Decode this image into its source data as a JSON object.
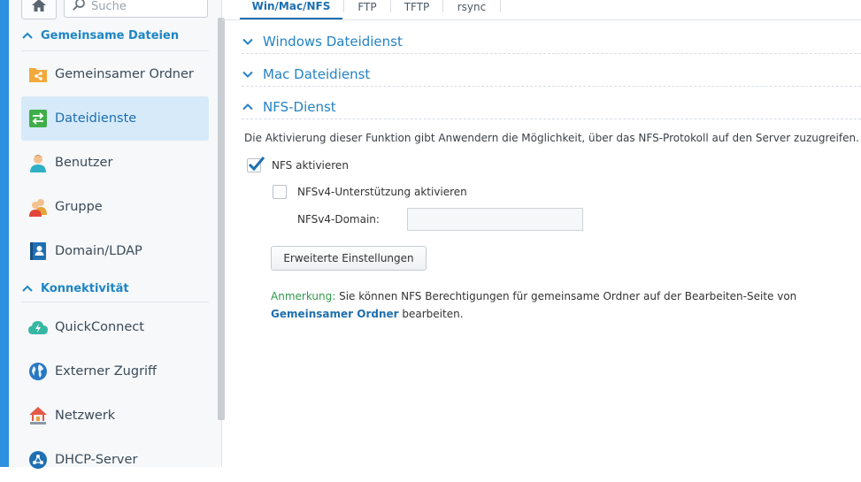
{
  "sidebar": {
    "search_placeholder": "Suche",
    "sections": [
      {
        "label": "Gemeinsame Dateien"
      },
      {
        "label": "Konnektivität"
      }
    ],
    "items": [
      {
        "label": "Gemeinsamer Ordner",
        "icon": "shared-folder-icon"
      },
      {
        "label": "Dateidienste",
        "icon": "file-services-icon",
        "active": true
      },
      {
        "label": "Benutzer",
        "icon": "user-icon"
      },
      {
        "label": "Gruppe",
        "icon": "group-icon"
      },
      {
        "label": "Domain/LDAP",
        "icon": "domain-ldap-icon"
      },
      {
        "label": "QuickConnect",
        "icon": "quickconnect-icon"
      },
      {
        "label": "Externer Zugriff",
        "icon": "external-access-icon"
      },
      {
        "label": "Netzwerk",
        "icon": "network-icon"
      },
      {
        "label": "DHCP-Server",
        "icon": "dhcp-server-icon"
      }
    ]
  },
  "tabs": [
    {
      "label": "Win/Mac/NFS",
      "active": true
    },
    {
      "label": "FTP"
    },
    {
      "label": "TFTP"
    },
    {
      "label": "rsync"
    }
  ],
  "accordion": [
    {
      "label": "Windows Dateidienst",
      "expanded": false
    },
    {
      "label": "Mac Dateidienst",
      "expanded": false
    },
    {
      "label": "NFS-Dienst",
      "expanded": true
    }
  ],
  "nfs": {
    "description": "Die Aktivierung dieser Funktion gibt Anwendern die Möglichkeit, über das NFS-Protokoll auf den Server zuzugreifen.",
    "enable_label": "NFS aktivieren",
    "enable_checked": true,
    "nfsv4_label": "NFSv4-Unterstützung aktivieren",
    "nfsv4_checked": false,
    "domain_label": "NFSv4-Domain:",
    "domain_value": "",
    "advanced_button": "Erweiterte Einstellungen",
    "note_prefix": "Anmerkung:",
    "note_text": " Sie können NFS Berechtigungen für gemeinsame Ordner auf der Bearbeiten-Seite von",
    "note_link": "Gemeinsamer Ordner",
    "note_suffix": " bearbeiten."
  },
  "colors": {
    "accent": "#1d6fb0",
    "active_item_bg": "#d6eaf9",
    "note_green": "#2d9a4a",
    "desktop_blue": "#2d8fe0"
  }
}
